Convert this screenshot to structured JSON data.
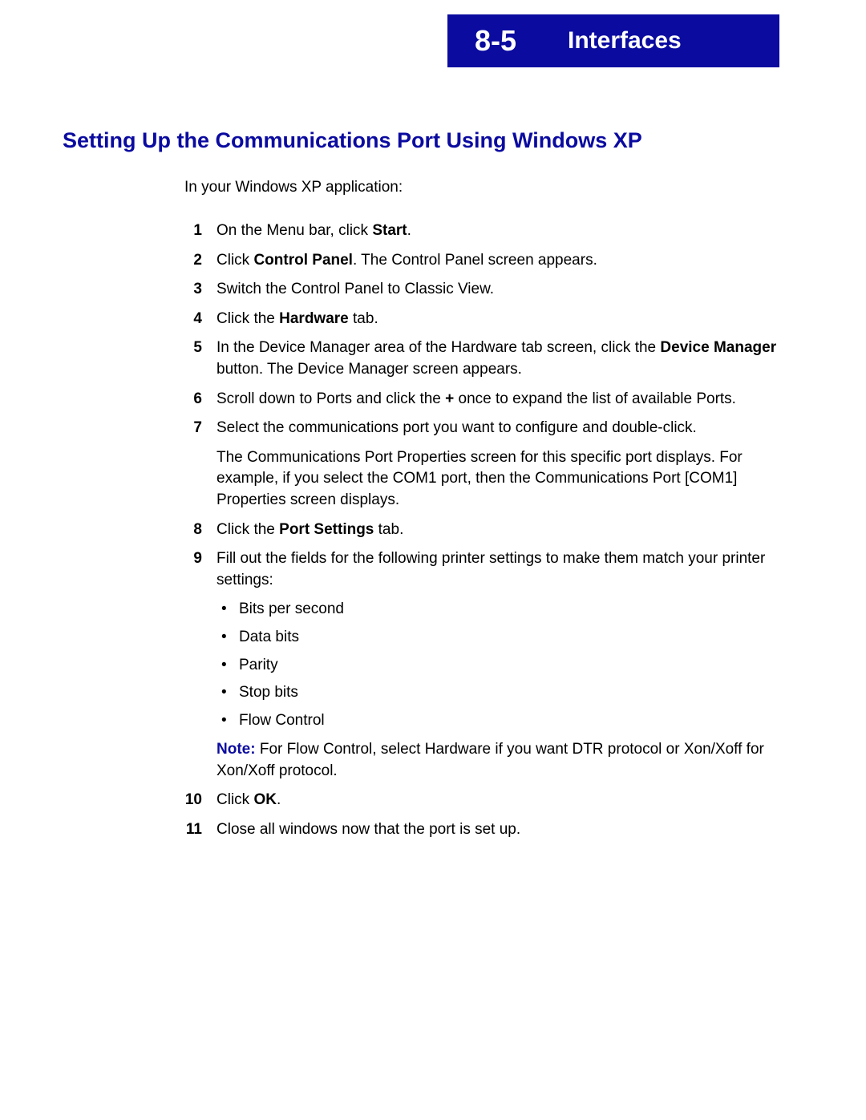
{
  "header": {
    "page_number": "8-5",
    "chapter_title": "Interfaces"
  },
  "section_title": "Setting Up the Communications Port Using Windows XP",
  "intro": "In your Windows XP application:",
  "steps": [
    {
      "num": "1",
      "parts": [
        [
          "On the Menu bar, click ",
          "b:Start",
          "."
        ]
      ]
    },
    {
      "num": "2",
      "parts": [
        [
          "Click ",
          "b:Control Panel",
          ". The Control Panel screen appears."
        ]
      ]
    },
    {
      "num": "3",
      "parts": [
        [
          "Switch the Control Panel to Classic View."
        ]
      ]
    },
    {
      "num": "4",
      "parts": [
        [
          "Click the ",
          "b:Hardware",
          " tab."
        ]
      ]
    },
    {
      "num": "5",
      "parts": [
        [
          "In the Device Manager area of the Hardware tab screen, click the ",
          "b:Device Manager",
          " button. The Device Manager screen appears."
        ]
      ]
    },
    {
      "num": "6",
      "parts": [
        [
          "Scroll down to Ports and click the ",
          "b:+",
          " once to expand the list of available Ports."
        ]
      ]
    },
    {
      "num": "7",
      "parts": [
        [
          "Select the communications port you want to configure and double-click."
        ],
        [
          "The Communications Port Properties screen for this specific port displays. For example, if you select the COM1 port, then the Communications Port [COM1] Properties screen displays."
        ]
      ]
    },
    {
      "num": "8",
      "parts": [
        [
          "Click the ",
          "b:Port Settings",
          " tab."
        ]
      ]
    },
    {
      "num": "9",
      "parts": [
        [
          "Fill out the fields for the following printer settings to make them match your printer settings:"
        ]
      ],
      "bullets": [
        "Bits per second",
        "Data bits",
        "Parity",
        "Stop bits",
        "Flow Control"
      ],
      "note": {
        "label": "Note:",
        "text": "  For Flow Control, select Hardware if you want DTR protocol or Xon/Xoff for Xon/Xoff protocol."
      }
    },
    {
      "num": "10",
      "parts": [
        [
          "Click ",
          "b:OK",
          "."
        ]
      ]
    },
    {
      "num": "11",
      "parts": [
        [
          "Close all windows now that the port is set up."
        ]
      ]
    }
  ]
}
